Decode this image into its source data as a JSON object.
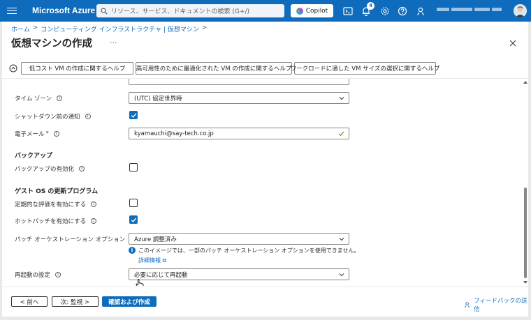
{
  "topbar": {
    "brand": "Microsoft Azure",
    "search_placeholder": "リソース、サービス、ドキュメントの検索 (G+/)",
    "copilot_label": "Copilot",
    "notifications_count": "4"
  },
  "breadcrumb": [
    "ホーム",
    "コンピューティング インフラストラクチャ | 仮想マシン"
  ],
  "page": {
    "title": "仮想マシンの作成",
    "more": "···"
  },
  "help_links": [
    "低コスト VM の作成に関するヘルプ",
    "高可用性のために最適化された VM の作成に関するヘルプ",
    "ワークロードに適した VM サイズの選択に関するヘルプ"
  ],
  "form": {
    "timezone": {
      "label": "タイム ゾーン",
      "value": "(UTC) 協定世界時"
    },
    "shutdown_notify": {
      "label": "シャットダウン前の通知",
      "checked": true
    },
    "email": {
      "label": "電子メール",
      "required_mark": "*",
      "value": "kyamauchi@say-tech.co.jp"
    },
    "backup_section": "バックアップ",
    "backup_enable": {
      "label": "バックアップの有効化",
      "checked": false
    },
    "guest_os_section": "ゲスト OS の更新プログラム",
    "periodic_assessment": {
      "label": "定期的な評価を有効にする",
      "checked": false
    },
    "hotpatch": {
      "label": "ホットパッチを有効にする",
      "checked": true
    },
    "patch_orchestration": {
      "label": "パッチ オーケストレーション オプション",
      "value": "Azure 調整済み",
      "note": "このイメージでは、一部のパッチ オーケストレーション オプションを使用できません。",
      "link": "詳細情報"
    },
    "reboot": {
      "label": "再起動の設定",
      "value": "必要に応じて再起動"
    }
  },
  "footer": {
    "prev": "< 前へ",
    "next": "次: 監視 >",
    "review": "確認および作成",
    "feedback": "フィードバックの送信"
  }
}
